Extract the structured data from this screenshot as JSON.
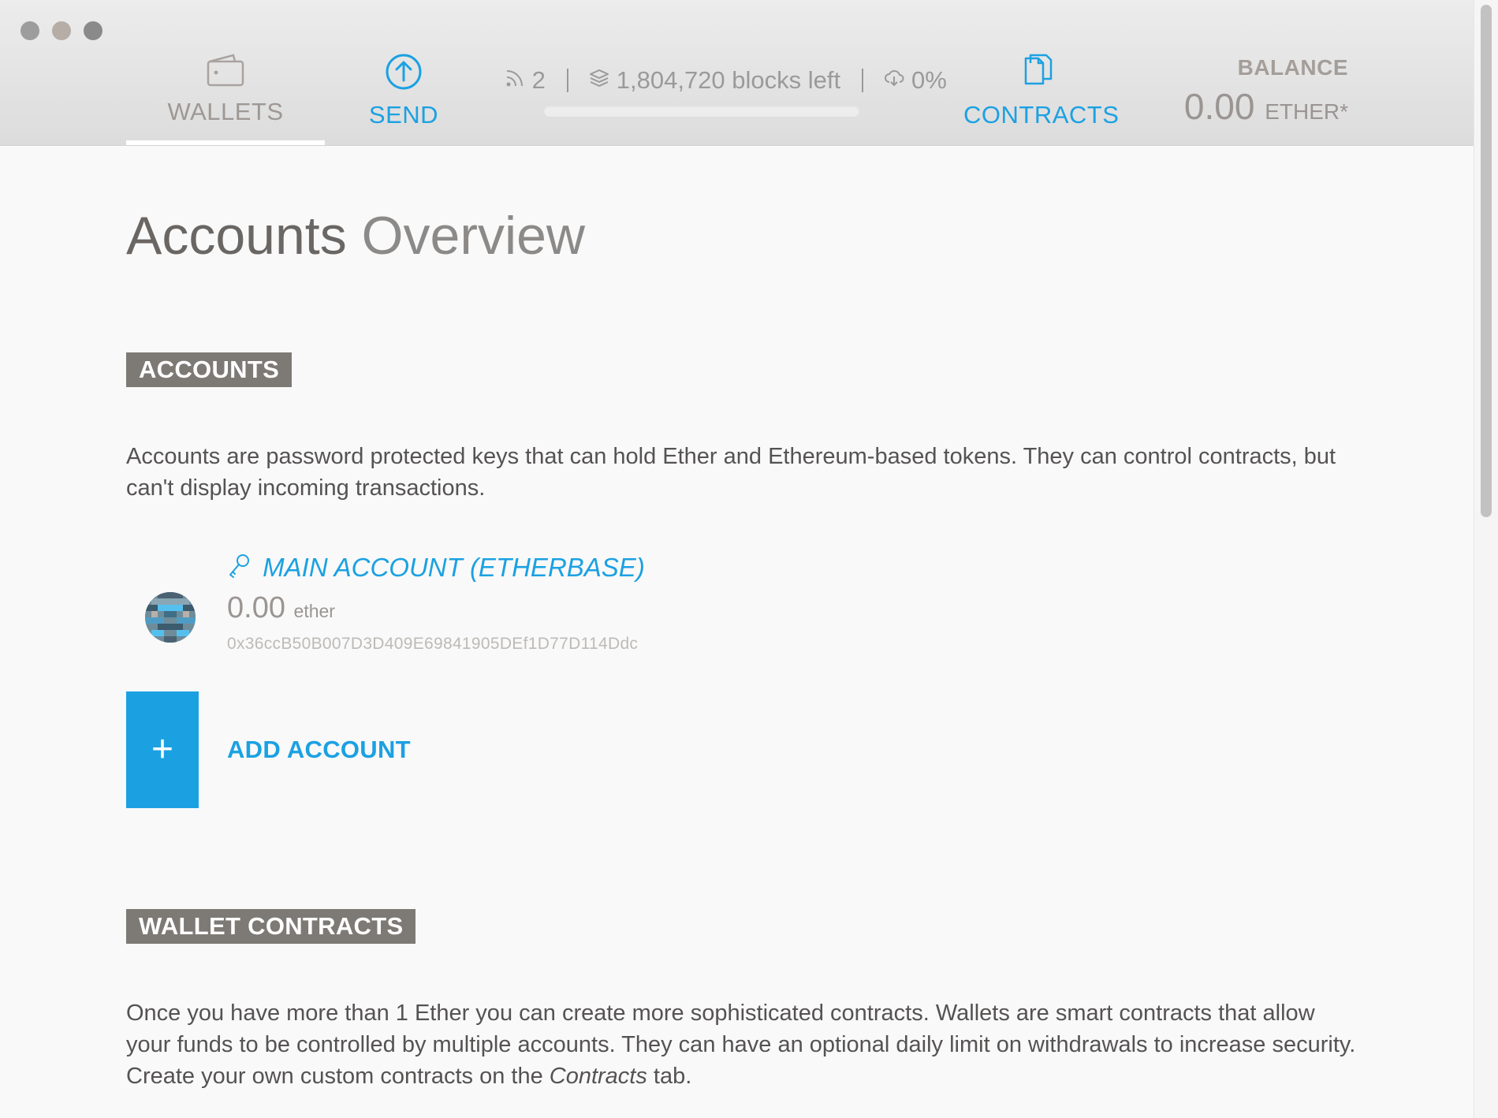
{
  "window": {
    "traffic_lights": [
      "close",
      "minimize",
      "maximize"
    ]
  },
  "nav": {
    "wallets_label": "WALLETS",
    "send_label": "SEND",
    "contracts_label": "CONTRACTS"
  },
  "status": {
    "peers": "2",
    "blocks_left": "1,804,720 blocks left",
    "download_percent": "0%",
    "sync_progress": 0
  },
  "balance": {
    "label": "BALANCE",
    "value": "0.00",
    "unit": "ETHER*"
  },
  "page": {
    "title_bold": "Accounts",
    "title_light": "Overview"
  },
  "accounts_section": {
    "tag": "ACCOUNTS",
    "description": "Accounts are password protected keys that can hold Ether and Ethereum-based tokens. They can control contracts, but can't display incoming transactions.",
    "accounts": [
      {
        "name": "MAIN ACCOUNT (ETHERBASE)",
        "balance": "0.00",
        "unit": "ether",
        "address": "0x36ccB50B007D3D409E69841905DEf1D77D114Ddc"
      }
    ],
    "add_button_symbol": "+",
    "add_label": "ADD ACCOUNT"
  },
  "wallet_contracts_section": {
    "tag": "WALLET CONTRACTS",
    "description_part1": "Once you have more than 1 Ether you can create more sophisticated contracts. Wallets are smart contracts that allow your funds to be controlled by multiple accounts. They can have an optional daily limit on withdrawals to increase security. Create your own custom contracts on the ",
    "description_em": "Contracts",
    "description_part2": " tab."
  },
  "colors": {
    "accent": "#1ba1e2",
    "tag_bg": "#7d7a75",
    "header_bg": "#e4e4e4"
  },
  "icons": {
    "wallets": "wallet-icon",
    "send": "arrow-up-circle-icon",
    "contracts": "documents-icon",
    "peers": "signal-icon",
    "blocks": "layers-icon",
    "download": "cloud-download-icon",
    "account_key": "key-icon"
  }
}
